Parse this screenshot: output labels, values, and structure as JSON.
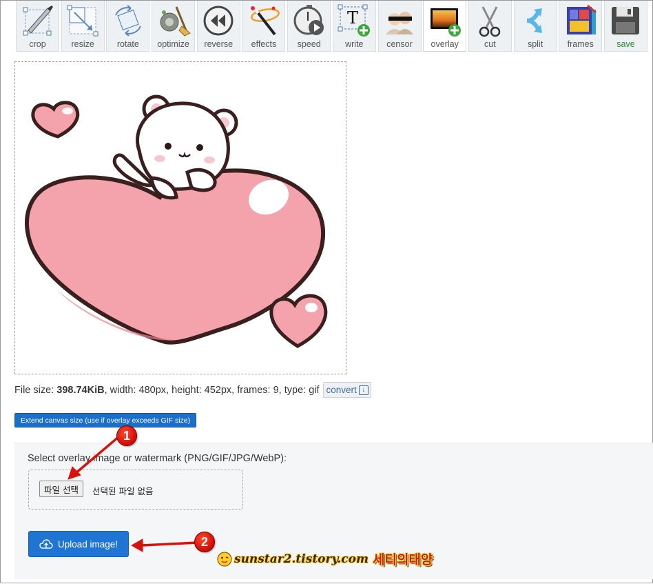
{
  "toolbar": {
    "tools": [
      {
        "label": "crop",
        "icon": "crop-icon"
      },
      {
        "label": "resize",
        "icon": "resize-icon"
      },
      {
        "label": "rotate",
        "icon": "rotate-icon"
      },
      {
        "label": "optimize",
        "icon": "optimize-icon"
      },
      {
        "label": "reverse",
        "icon": "reverse-icon"
      },
      {
        "label": "effects",
        "icon": "magic-wand-icon"
      },
      {
        "label": "speed",
        "icon": "stopwatch-icon"
      },
      {
        "label": "write",
        "icon": "text-add-icon"
      },
      {
        "label": "censor",
        "icon": "censor-icon"
      },
      {
        "label": "overlay",
        "icon": "image-add-icon",
        "active": true
      },
      {
        "label": "cut",
        "icon": "scissors-icon"
      },
      {
        "label": "split",
        "icon": "split-arrows-icon"
      },
      {
        "label": "frames",
        "icon": "frames-icon"
      },
      {
        "label": "save",
        "icon": "floppy-disk-icon"
      }
    ]
  },
  "file_info": {
    "prefix": "File size: ",
    "size": "398.74KiB",
    "rest": ", width: 480px, height: 452px, frames: 9, type: gif",
    "convert_label": "convert"
  },
  "extend_button": "Extend canvas size (use if overlay exceeds GIF size)",
  "overlay_panel": {
    "label": "Select overlay image or watermark (PNG/GIF/JPG/WebP):",
    "file_button": "파일 선택",
    "no_file_text": "선택된 파일 없음",
    "upload_button": "Upload image!"
  },
  "annotations": {
    "marker_1": "1",
    "marker_2": "2",
    "marker_color": "#d8120a"
  },
  "watermark": {
    "url": "sunstar2.tistory.com",
    "korean": "세티의태양"
  },
  "colors": {
    "primary_button": "#1f74d4",
    "heart_pink": "#f4a3ad",
    "save_green": "#2e8b2e"
  }
}
